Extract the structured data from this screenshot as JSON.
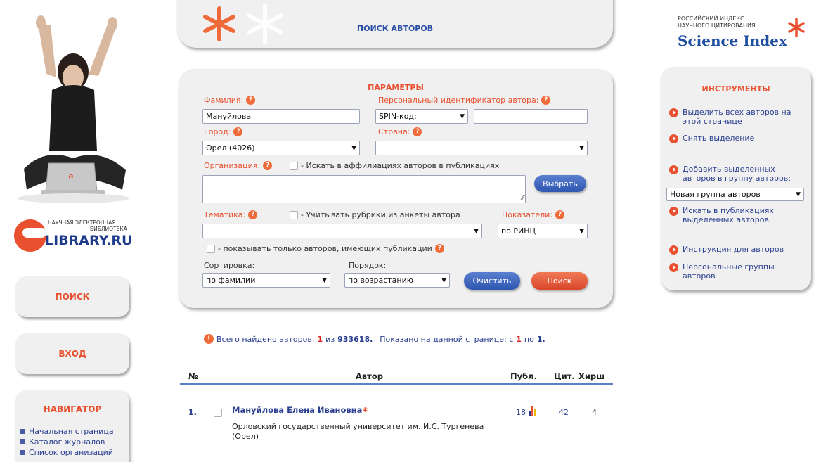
{
  "page": {
    "header_title": "ПОИСК АВТОРОВ"
  },
  "brand": {
    "index_line1": "РОССИЙСКИЙ ИНДЕКС",
    "index_line2": "НАУЧНОГО ЦИТИРОВАНИЯ",
    "index_name": "Science Index",
    "elib_line1": "НАУЧНАЯ ЭЛЕКТРОННАЯ",
    "elib_line2": "БИБЛИОТЕКА",
    "elib_name": "LIBRARY.RU",
    "accent": "#e8502f",
    "link_blue": "#2a3f8f"
  },
  "left_nav": {
    "search_button": "ПОИСК",
    "login_button": "ВХОД",
    "navigator_title": "НАВИГАТОР",
    "items": [
      "Начальная страница",
      "Каталог журналов",
      "Список организаций"
    ]
  },
  "params": {
    "title": "ПАРАМЕТРЫ",
    "surname_label": "Фамилия:",
    "surname_value": "Мануйлова",
    "author_id_label": "Персональный идентификатор автора:",
    "author_id_type": "SPIN-код:",
    "author_id_value": "",
    "city_label": "Город:",
    "city_value": "Орел  (4026)",
    "country_label": "Страна:",
    "country_value": "",
    "org_label": "Организация:",
    "org_affil_label": "- Искать в аффилиациях авторов в публикациях",
    "org_value": "",
    "choose_button": "Выбрать",
    "topic_label": "Тематика:",
    "topic_rubrics_label": "- Учитывать рубрики из анкеты автора",
    "topic_value": "",
    "indicators_label": "Показатели:",
    "indicators_value": "по РИНЦ",
    "only_with_pubs_label": "- показывать только авторов, имеющих публикации",
    "sort_label": "Сортировка:",
    "sort_value": "по фамилии",
    "order_label": "Порядок:",
    "order_value": "по возрастанию",
    "clear_button": "Очистить",
    "search_button": "Поиск"
  },
  "tools": {
    "title": "ИНСТРУМЕНТЫ",
    "select_all": "Выделить всех авторов на этой странице",
    "deselect": "Снять выделение",
    "add_to_group": "Добавить выделенных авторов в группу авторов:",
    "group_value": "Новая группа авторов",
    "search_pubs": "Искать в публикациях выделенных авторов",
    "instructions": "Инструкция для авторов",
    "personal_groups": "Персональные группы авторов"
  },
  "results": {
    "found_prefix": "Всего найдено авторов:",
    "found_count": "1",
    "found_of": "из",
    "found_total": "933618.",
    "shown_prefix": "Показано на данной странице: с",
    "shown_from": "1",
    "shown_to_word": "по",
    "shown_to": "1.",
    "columns": {
      "num": "№",
      "author": "Автор",
      "pubs": "Публ.",
      "cites": "Цит.",
      "hirsch": "Хирш"
    },
    "rows": [
      {
        "num": "1.",
        "name": "Мануйлова  Елена  Ивановна",
        "affiliation_line1": "Орловский государственный университет им. И.С. Тургенева",
        "affiliation_line2": "(Орел)",
        "pubs": "18",
        "cites": "42",
        "hirsch": "4"
      }
    ]
  }
}
